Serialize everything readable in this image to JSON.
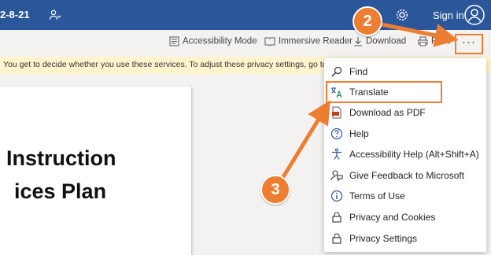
{
  "topbar": {
    "doc_title": "2-8-21",
    "sign_in": "Sign in",
    "icons": [
      "people-icon",
      "gear-icon",
      "avatar-icon"
    ],
    "bar_color": "#2b579a"
  },
  "commands": {
    "accessibility_mode": "Accessibility Mode",
    "immersive_reader": "Immersive Reader",
    "download": "Download",
    "print": "Print",
    "more": "···"
  },
  "privacy_bar": {
    "text": "You get to decide whether you use these services. To adjust these privacy settings, go to the C"
  },
  "document": {
    "heading_line1": "Instruction",
    "heading_line2": "ices Plan"
  },
  "menu": {
    "items": [
      {
        "label": "Find",
        "icon": "search-icon"
      },
      {
        "label": "Translate",
        "icon": "translate-icon"
      },
      {
        "label": "Download as PDF",
        "icon": "pdf-icon"
      },
      {
        "label": "Help",
        "icon": "help-icon"
      },
      {
        "label": "Accessibility Help (Alt+Shift+A)",
        "icon": "accessibility-icon"
      },
      {
        "label": "Give Feedback to Microsoft",
        "icon": "feedback-icon"
      },
      {
        "label": "Terms of Use",
        "icon": "info-icon"
      },
      {
        "label": "Privacy and Cookies",
        "icon": "lock-icon"
      },
      {
        "label": "Privacy Settings",
        "icon": "lock-icon"
      }
    ]
  },
  "annotations": {
    "step2": "2",
    "step3": "3",
    "accent_color": "#ed7d31"
  }
}
